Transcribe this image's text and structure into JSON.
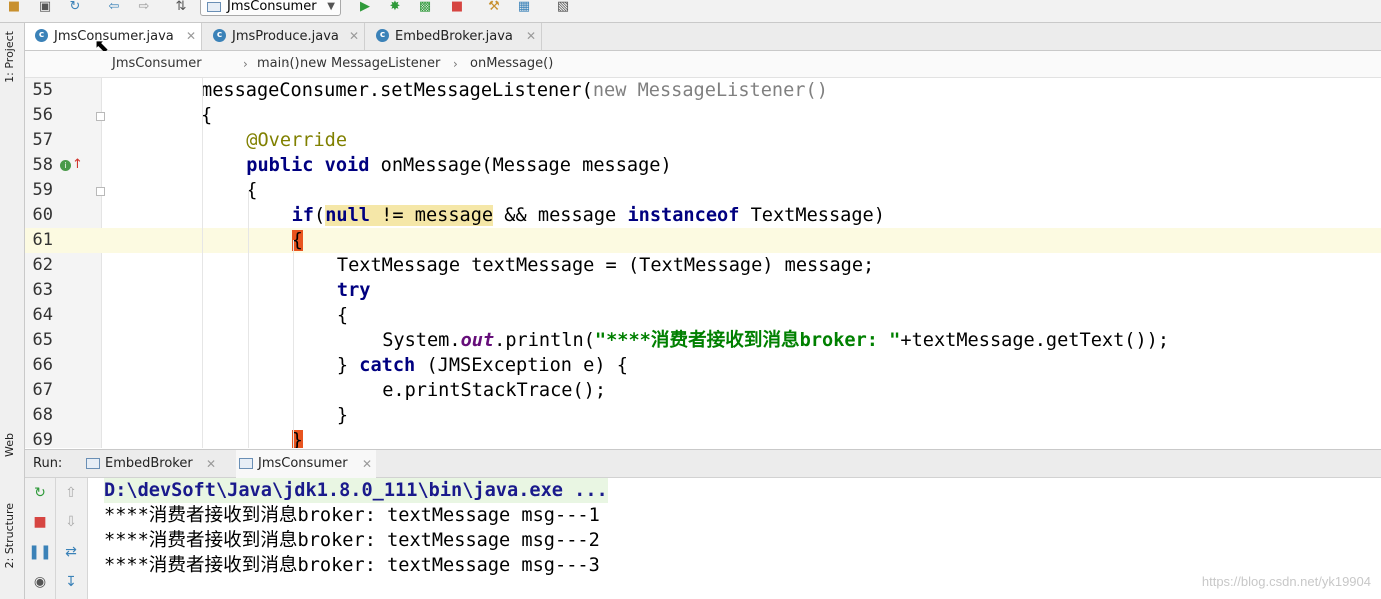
{
  "toolbar": {
    "run_config": "JmsConsumer",
    "icons": [
      "folder-icon",
      "save-icon",
      "sync-icon",
      "back-icon",
      "forward-icon",
      "build-icon",
      "run-icon",
      "debug-icon",
      "coverage-icon",
      "stop-icon",
      "project-structure-icon",
      "sdk-icon",
      "vcs-icon"
    ]
  },
  "side_tools": {
    "project": "1: Project",
    "web": "Web",
    "structure": "2: Structure"
  },
  "tabs": [
    {
      "label": "JmsConsumer.java",
      "active": true
    },
    {
      "label": "JmsProduce.java",
      "active": false
    },
    {
      "label": "EmbedBroker.java",
      "active": false
    }
  ],
  "breadcrumb": [
    "JmsConsumer",
    "main()",
    "new MessageListener",
    "onMessage()"
  ],
  "editor": {
    "current_line": "61",
    "lines": [
      {
        "n": "55",
        "indent": 4,
        "t": [
          [
            "",
            "messageConsumer.setMessageListener("
          ],
          [
            "kw-gray",
            "new MessageListener()"
          ]
        ]
      },
      {
        "n": "56",
        "indent": 4,
        "t": [
          [
            "",
            "{"
          ]
        ]
      },
      {
        "n": "57",
        "indent": 5,
        "t": [
          [
            "ann",
            "@Override"
          ]
        ]
      },
      {
        "n": "58",
        "indent": 5,
        "t": [
          [
            "kw",
            "public void "
          ],
          [
            "",
            "onMessage(Message message)"
          ]
        ]
      },
      {
        "n": "59",
        "indent": 5,
        "t": [
          [
            "",
            "{"
          ]
        ]
      },
      {
        "n": "60",
        "indent": 6,
        "t": [
          [
            "kw",
            "if"
          ],
          [
            "",
            "("
          ],
          [
            "hl-kw",
            "null"
          ],
          [
            "hl",
            " != message"
          ],
          [
            "",
            " && message "
          ],
          [
            "kw",
            "instanceof"
          ],
          [
            "",
            " TextMessage)"
          ]
        ]
      },
      {
        "n": "61",
        "indent": 6,
        "t": [
          [
            "mark",
            "{"
          ]
        ]
      },
      {
        "n": "62",
        "indent": 7,
        "t": [
          [
            "",
            "TextMessage textMessage = (TextMessage) message;"
          ]
        ]
      },
      {
        "n": "63",
        "indent": 7,
        "t": [
          [
            "kw",
            "try"
          ]
        ]
      },
      {
        "n": "64",
        "indent": 7,
        "t": [
          [
            "",
            "{"
          ]
        ]
      },
      {
        "n": "65",
        "indent": 8,
        "t": [
          [
            "",
            "System."
          ],
          [
            "stat",
            "out"
          ],
          [
            "",
            ".println("
          ],
          [
            "str",
            "\"****消费者接收到消息broker: \""
          ],
          [
            "",
            "+textMessage.getText());"
          ]
        ]
      },
      {
        "n": "66",
        "indent": 7,
        "t": [
          [
            "",
            "} "
          ],
          [
            "kw",
            "catch"
          ],
          [
            "",
            " (JMSException e) {"
          ]
        ]
      },
      {
        "n": "67",
        "indent": 8,
        "t": [
          [
            "",
            "e.printStackTrace();"
          ]
        ]
      },
      {
        "n": "68",
        "indent": 7,
        "t": [
          [
            "",
            "}"
          ]
        ]
      },
      {
        "n": "69",
        "indent": 6,
        "t": [
          [
            "mark",
            "}"
          ]
        ]
      }
    ]
  },
  "run_panel": {
    "label": "Run:",
    "tabs": [
      {
        "label": "EmbedBroker",
        "active": false
      },
      {
        "label": "JmsConsumer",
        "active": true
      }
    ],
    "console": [
      "D:\\devSoft\\Java\\jdk1.8.0_111\\bin\\java.exe ...",
      "****消费者接收到消息broker: textMessage msg---1",
      "****消费者接收到消息broker: textMessage msg---2",
      "****消费者接收到消息broker: textMessage msg---3"
    ]
  },
  "watermark": "https://blog.csdn.net/yk19904",
  "colors": {
    "keyword": "#000080",
    "string": "#008000",
    "annotation": "#808000",
    "current_line": "#fcfae1",
    "highlight": "#f5e7a8",
    "brace_mark": "#e8541f"
  }
}
